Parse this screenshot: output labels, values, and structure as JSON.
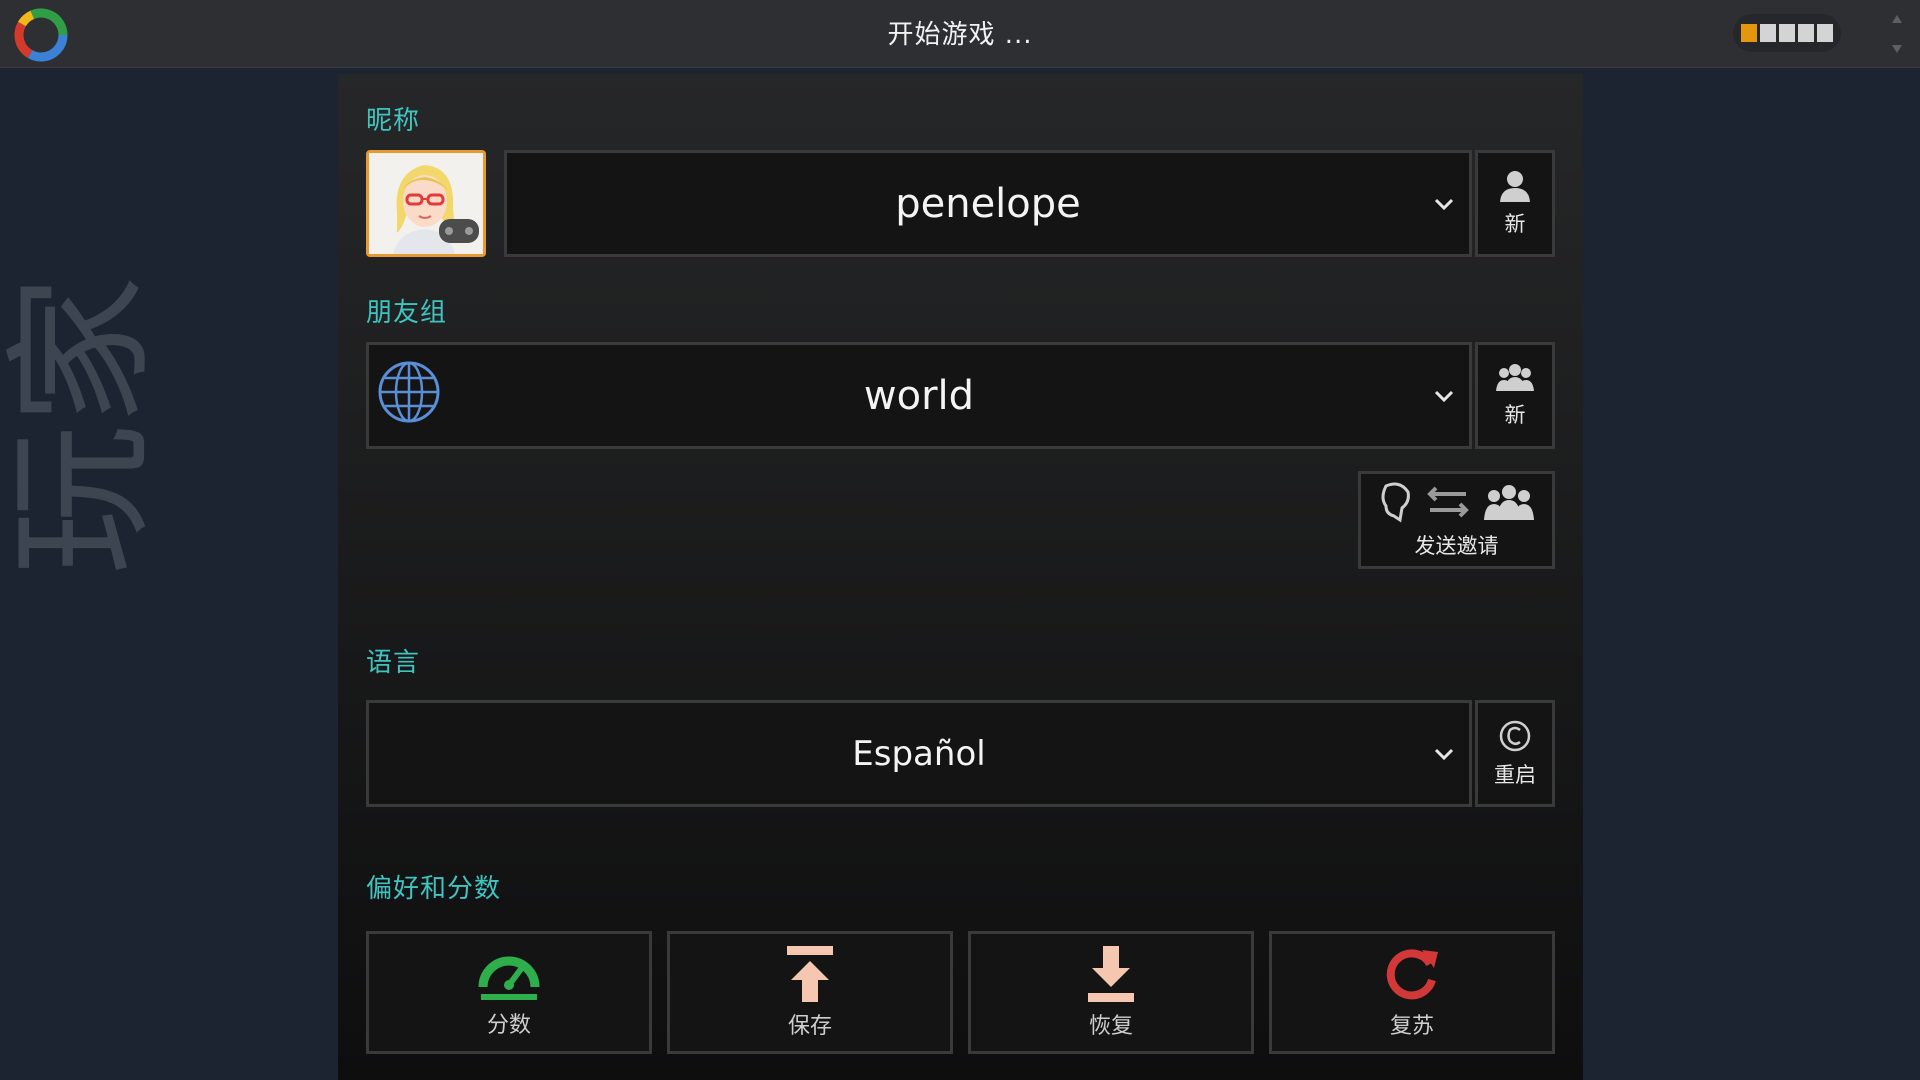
{
  "header": {
    "title": "开始游戏 ...",
    "level": {
      "segments": 5,
      "filled": 1
    }
  },
  "sidebar": {
    "vertical_text": "玩家"
  },
  "nickname": {
    "section_label": "昵称",
    "value": "penelope",
    "new_button_label": "新"
  },
  "friend_group": {
    "section_label": "朋友组",
    "value": "world",
    "new_button_label": "新",
    "invite_button_label": "发送邀请"
  },
  "language": {
    "section_label": "语言",
    "value": "Español",
    "restart_button_label": "重启"
  },
  "prefs": {
    "section_label": "偏好和分数",
    "buttons": [
      {
        "label": "分数",
        "icon": "gauge-icon",
        "color": "#2fae4c"
      },
      {
        "label": "保存",
        "icon": "upload-icon",
        "color": "#f5c7b0"
      },
      {
        "label": "恢复",
        "icon": "download-icon",
        "color": "#f5c7b0"
      },
      {
        "label": "复苏",
        "icon": "revive-icon",
        "color": "#d23838"
      }
    ]
  },
  "colors": {
    "accent_label": "#3fc4c0",
    "avatar_border": "#e79a31",
    "level_on": "#e3960e"
  }
}
